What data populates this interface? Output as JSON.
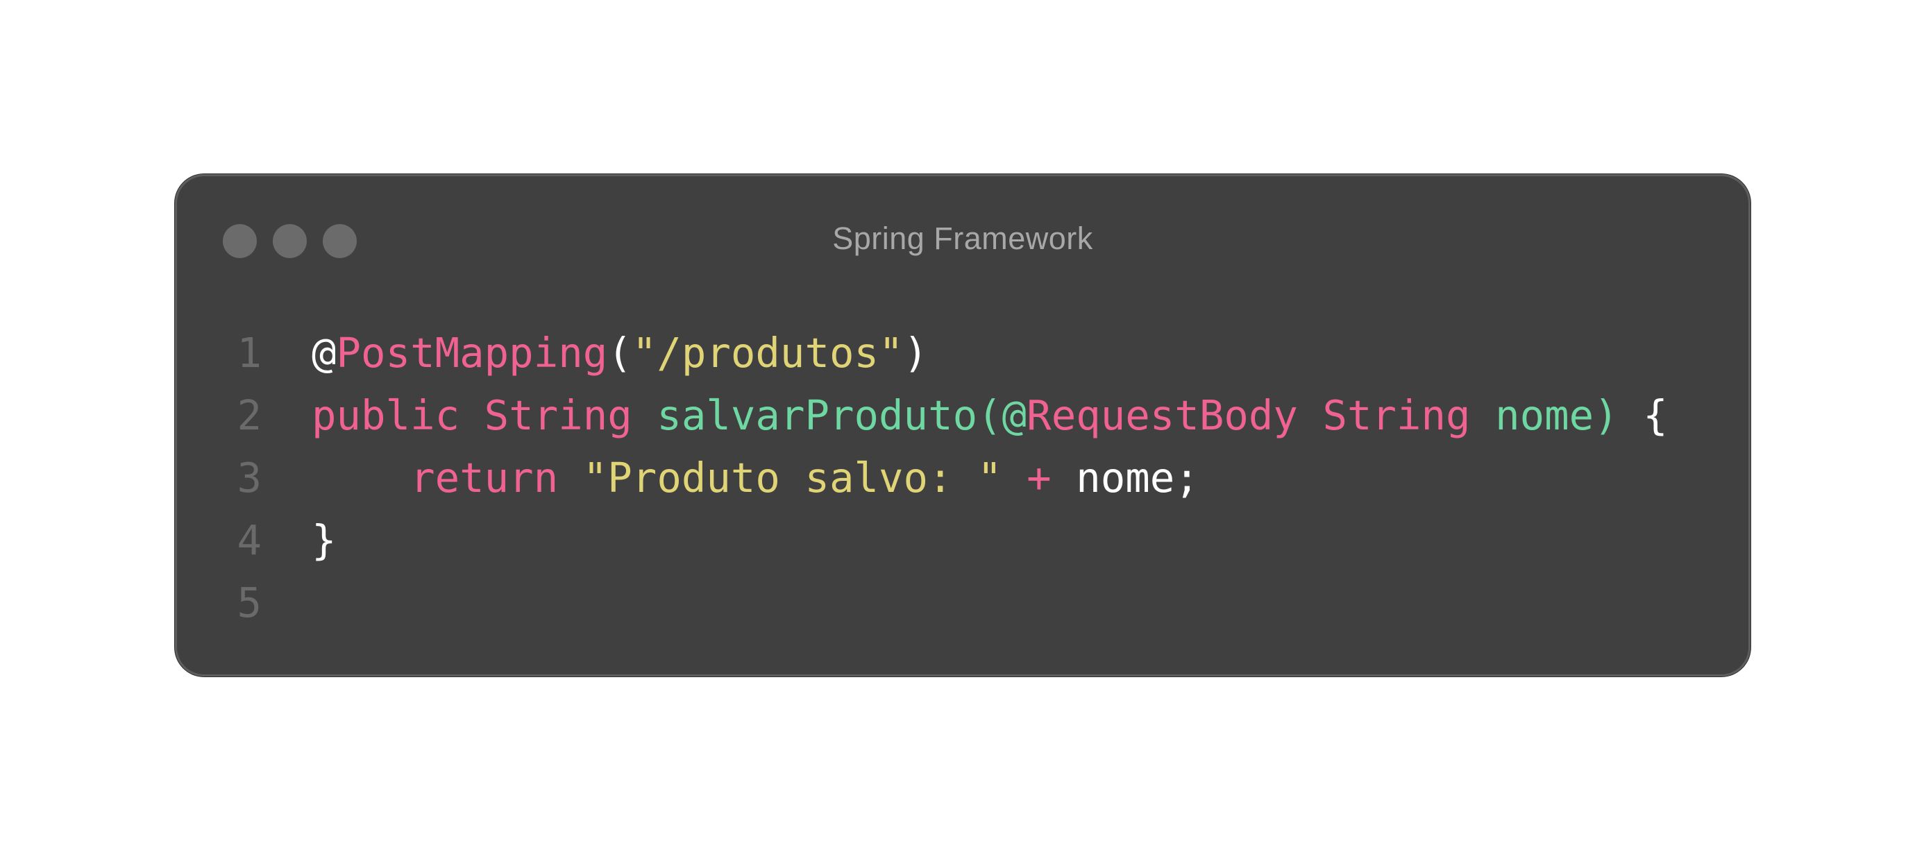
{
  "window": {
    "title": "Spring Framework",
    "background": "#404040",
    "controls": [
      "close-dot",
      "minimize-dot",
      "zoom-dot"
    ]
  },
  "colors": {
    "keyword": "#f06292",
    "string": "#e0d476",
    "function": "#6ed7a2",
    "plain": "#ffffff",
    "line_number": "#6a6a6a"
  },
  "code": {
    "lines": [
      {
        "number": "1",
        "tokens": [
          {
            "text": "@",
            "type": "txt"
          },
          {
            "text": "PostMapping",
            "type": "kw"
          },
          {
            "text": "(",
            "type": "txt"
          },
          {
            "text": "\"/produtos\"",
            "type": "str"
          },
          {
            "text": ")",
            "type": "txt"
          }
        ]
      },
      {
        "number": "2",
        "tokens": [
          {
            "text": "public",
            "type": "kw"
          },
          {
            "text": " ",
            "type": "txt"
          },
          {
            "text": "String",
            "type": "kw"
          },
          {
            "text": " ",
            "type": "txt"
          },
          {
            "text": "salvarProduto(@",
            "type": "fn"
          },
          {
            "text": "RequestBody",
            "type": "kw"
          },
          {
            "text": " ",
            "type": "txt"
          },
          {
            "text": "String",
            "type": "kw"
          },
          {
            "text": " ",
            "type": "txt"
          },
          {
            "text": "nome)",
            "type": "fn"
          },
          {
            "text": " {",
            "type": "txt"
          }
        ]
      },
      {
        "number": "3",
        "tokens": [
          {
            "text": "    ",
            "type": "txt"
          },
          {
            "text": "return",
            "type": "kw"
          },
          {
            "text": " ",
            "type": "txt"
          },
          {
            "text": "\"Produto salvo: \"",
            "type": "str"
          },
          {
            "text": " ",
            "type": "txt"
          },
          {
            "text": "+",
            "type": "kw"
          },
          {
            "text": " nome;",
            "type": "txt"
          }
        ]
      },
      {
        "number": "4",
        "tokens": [
          {
            "text": "}",
            "type": "txt"
          }
        ]
      },
      {
        "number": "5",
        "tokens": []
      }
    ]
  }
}
